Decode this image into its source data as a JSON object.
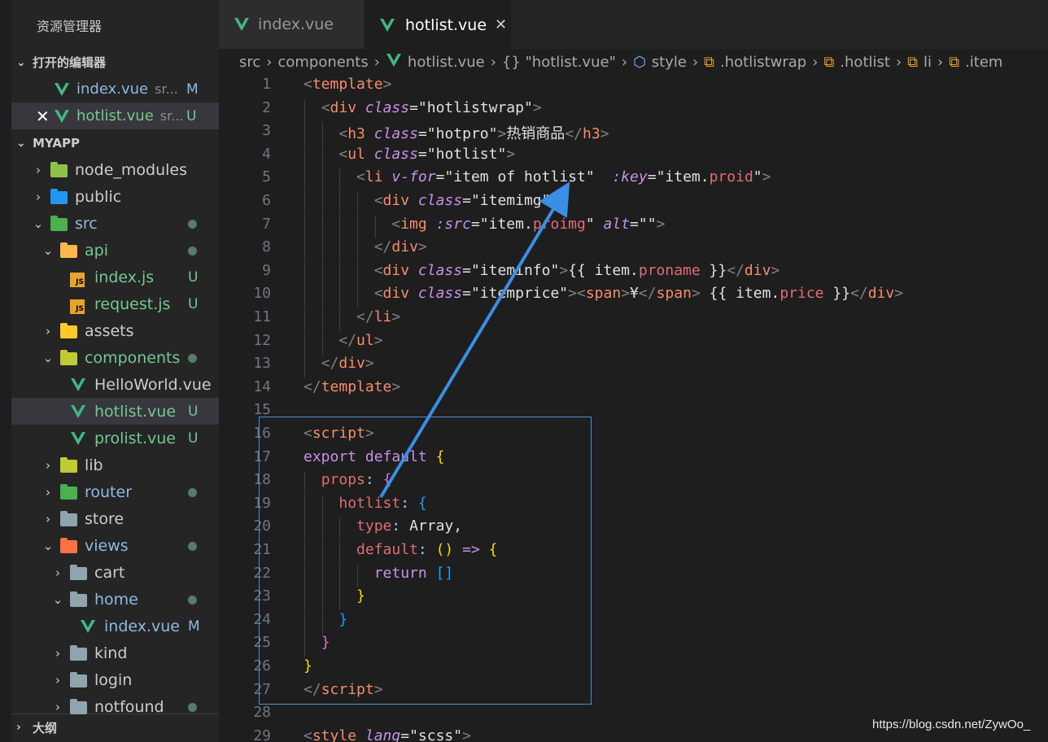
{
  "sidebar": {
    "title": "资源管理器",
    "open_editors": {
      "label": "打开的编辑器",
      "items": [
        {
          "name": "index.vue",
          "path": "sr...",
          "badge": "M",
          "active": false
        },
        {
          "name": "hotlist.vue",
          "path": "sr...",
          "badge": "U",
          "active": true
        }
      ]
    },
    "project": {
      "label": "MYAPP",
      "tree": [
        {
          "name": "node_modules",
          "indent": 0,
          "type": "folder",
          "icon_color": "#8bc34a",
          "chevron": "right"
        },
        {
          "name": "public",
          "indent": 0,
          "type": "folder",
          "icon_color": "#2196f3",
          "chevron": "right"
        },
        {
          "name": "src",
          "indent": 0,
          "type": "folder",
          "icon_color": "#4caf50",
          "chevron": "down",
          "dot": true,
          "color": "blue"
        },
        {
          "name": "api",
          "indent": 1,
          "type": "folder",
          "icon_color": "#ffb74d",
          "chevron": "down",
          "dot": true,
          "color": "mod"
        },
        {
          "name": "index.js",
          "indent": 2,
          "type": "js",
          "badge": "U",
          "color": "mod"
        },
        {
          "name": "request.js",
          "indent": 2,
          "type": "js",
          "badge": "U",
          "color": "mod"
        },
        {
          "name": "assets",
          "indent": 1,
          "type": "folder",
          "icon_color": "#ffca28",
          "chevron": "right"
        },
        {
          "name": "components",
          "indent": 1,
          "type": "folder",
          "icon_color": "#c0ca33",
          "chevron": "down",
          "dot": true,
          "color": "mod"
        },
        {
          "name": "HelloWorld.vue",
          "indent": 2,
          "type": "vue"
        },
        {
          "name": "hotlist.vue",
          "indent": 2,
          "type": "vue",
          "badge": "U",
          "color": "mod",
          "selected": true
        },
        {
          "name": "prolist.vue",
          "indent": 2,
          "type": "vue",
          "badge": "U",
          "color": "mod"
        },
        {
          "name": "lib",
          "indent": 1,
          "type": "folder",
          "icon_color": "#c0ca33",
          "chevron": "right"
        },
        {
          "name": "router",
          "indent": 1,
          "type": "folder",
          "icon_color": "#4caf50",
          "chevron": "right",
          "dot": true,
          "color": "blue"
        },
        {
          "name": "store",
          "indent": 1,
          "type": "folder",
          "icon_color": "#90a4ae",
          "chevron": "right"
        },
        {
          "name": "views",
          "indent": 1,
          "type": "folder",
          "icon_color": "#ff7043",
          "chevron": "down",
          "dot": true,
          "color": "blue"
        },
        {
          "name": "cart",
          "indent": 2,
          "type": "folder",
          "icon_color": "#90a4ae",
          "chevron": "right"
        },
        {
          "name": "home",
          "indent": 2,
          "type": "folder",
          "icon_color": "#90a4ae",
          "chevron": "down",
          "dot": true,
          "color": "blue"
        },
        {
          "name": "index.vue",
          "indent": 3,
          "type": "vue",
          "badge": "M",
          "color": "blue"
        },
        {
          "name": "kind",
          "indent": 2,
          "type": "folder",
          "icon_color": "#90a4ae",
          "chevron": "right"
        },
        {
          "name": "login",
          "indent": 2,
          "type": "folder",
          "icon_color": "#90a4ae",
          "chevron": "right"
        },
        {
          "name": "notfound",
          "indent": 2,
          "type": "folder",
          "icon_color": "#90a4ae",
          "chevron": "right",
          "dot": true
        }
      ]
    },
    "outline_label": "大纲"
  },
  "tabs": [
    {
      "name": "index.vue",
      "active": false
    },
    {
      "name": "hotlist.vue",
      "active": true,
      "close": "✕"
    }
  ],
  "breadcrumb": [
    "src",
    "components",
    "hotlist.vue",
    "{} \"hotlist.vue\"",
    "style",
    ".hotlistwrap",
    ".hotlist",
    "li",
    ".item"
  ],
  "code": {
    "line_numbers": [
      "1",
      "2",
      "3",
      "4",
      "5",
      "6",
      "7",
      "8",
      "9",
      "10",
      "11",
      "12",
      "13",
      "14",
      "15",
      "16",
      "17",
      "18",
      "19",
      "20",
      "21",
      "22",
      "23",
      "24",
      "25",
      "26",
      "27",
      "28",
      "29"
    ],
    "lines": [
      [
        {
          "t": "<",
          "c": "tagb"
        },
        {
          "t": "template",
          "c": "tag"
        },
        {
          "t": ">",
          "c": "tagb"
        }
      ],
      [
        {
          "t": "  "
        },
        {
          "t": "<",
          "c": "tagb"
        },
        {
          "t": "div",
          "c": "tag"
        },
        {
          "t": " "
        },
        {
          "t": "class",
          "c": "attr"
        },
        {
          "t": "=",
          "c": "plain"
        },
        {
          "t": "\"hotlistwrap\"",
          "c": "strw"
        },
        {
          "t": ">",
          "c": "tagb"
        }
      ],
      [
        {
          "t": "    "
        },
        {
          "t": "<",
          "c": "tagb"
        },
        {
          "t": "h3",
          "c": "tag"
        },
        {
          "t": " "
        },
        {
          "t": "class",
          "c": "attr"
        },
        {
          "t": "=",
          "c": "plain"
        },
        {
          "t": "\"hotpro\"",
          "c": "strw"
        },
        {
          "t": ">",
          "c": "tagb"
        },
        {
          "t": "热销商品",
          "c": "plain"
        },
        {
          "t": "</",
          "c": "tagb"
        },
        {
          "t": "h3",
          "c": "tag"
        },
        {
          "t": ">",
          "c": "tagb"
        }
      ],
      [
        {
          "t": "    "
        },
        {
          "t": "<",
          "c": "tagb"
        },
        {
          "t": "ul",
          "c": "tag"
        },
        {
          "t": " "
        },
        {
          "t": "class",
          "c": "attr"
        },
        {
          "t": "=",
          "c": "plain"
        },
        {
          "t": "\"hotlist\"",
          "c": "strw"
        },
        {
          "t": ">",
          "c": "tagb"
        }
      ],
      [
        {
          "t": "      "
        },
        {
          "t": "<",
          "c": "tagb"
        },
        {
          "t": "li",
          "c": "tag"
        },
        {
          "t": " "
        },
        {
          "t": "v-for",
          "c": "attr"
        },
        {
          "t": "=",
          "c": "plain"
        },
        {
          "t": "\"item of hotlist\"",
          "c": "strw"
        },
        {
          "t": "  "
        },
        {
          "t": ":key",
          "c": "attr"
        },
        {
          "t": "=",
          "c": "plain"
        },
        {
          "t": "\"item.",
          "c": "strw"
        },
        {
          "t": "proid",
          "c": "prop"
        },
        {
          "t": "\"",
          "c": "strw"
        },
        {
          "t": ">",
          "c": "tagb"
        }
      ],
      [
        {
          "t": "        "
        },
        {
          "t": "<",
          "c": "tagb"
        },
        {
          "t": "div",
          "c": "tag"
        },
        {
          "t": " "
        },
        {
          "t": "class",
          "c": "attr"
        },
        {
          "t": "=",
          "c": "plain"
        },
        {
          "t": "\"itemimg\"",
          "c": "strw"
        },
        {
          "t": ">",
          "c": "tagb"
        }
      ],
      [
        {
          "t": "          "
        },
        {
          "t": "<",
          "c": "tagb"
        },
        {
          "t": "img",
          "c": "tag"
        },
        {
          "t": " "
        },
        {
          "t": ":src",
          "c": "attr"
        },
        {
          "t": "=",
          "c": "plain"
        },
        {
          "t": "\"item.",
          "c": "strw"
        },
        {
          "t": "proimg",
          "c": "prop"
        },
        {
          "t": "\"",
          "c": "strw"
        },
        {
          "t": " "
        },
        {
          "t": "alt",
          "c": "attr"
        },
        {
          "t": "=",
          "c": "plain"
        },
        {
          "t": "\"\"",
          "c": "strw"
        },
        {
          "t": ">",
          "c": "tagb"
        }
      ],
      [
        {
          "t": "        "
        },
        {
          "t": "</",
          "c": "tagb"
        },
        {
          "t": "div",
          "c": "tag"
        },
        {
          "t": ">",
          "c": "tagb"
        }
      ],
      [
        {
          "t": "        "
        },
        {
          "t": "<",
          "c": "tagb"
        },
        {
          "t": "div",
          "c": "tag"
        },
        {
          "t": " "
        },
        {
          "t": "class",
          "c": "attr"
        },
        {
          "t": "=",
          "c": "plain"
        },
        {
          "t": "\"iteminfo\"",
          "c": "strw"
        },
        {
          "t": ">",
          "c": "tagb"
        },
        {
          "t": "{{ item.",
          "c": "plain"
        },
        {
          "t": "proname",
          "c": "prop"
        },
        {
          "t": " }}",
          "c": "plain"
        },
        {
          "t": "</",
          "c": "tagb"
        },
        {
          "t": "div",
          "c": "tag"
        },
        {
          "t": ">",
          "c": "tagb"
        }
      ],
      [
        {
          "t": "        "
        },
        {
          "t": "<",
          "c": "tagb"
        },
        {
          "t": "div",
          "c": "tag"
        },
        {
          "t": " "
        },
        {
          "t": "class",
          "c": "attr"
        },
        {
          "t": "=",
          "c": "plain"
        },
        {
          "t": "\"itemprice\"",
          "c": "strw"
        },
        {
          "t": ">",
          "c": "tagb"
        },
        {
          "t": "<",
          "c": "tagb"
        },
        {
          "t": "span",
          "c": "tag"
        },
        {
          "t": ">",
          "c": "tagb"
        },
        {
          "t": "¥",
          "c": "plain"
        },
        {
          "t": "</",
          "c": "tagb"
        },
        {
          "t": "span",
          "c": "tag"
        },
        {
          "t": ">",
          "c": "tagb"
        },
        {
          "t": " {{ item.",
          "c": "plain"
        },
        {
          "t": "price",
          "c": "prop"
        },
        {
          "t": " }}",
          "c": "plain"
        },
        {
          "t": "</",
          "c": "tagb"
        },
        {
          "t": "div",
          "c": "tag"
        },
        {
          "t": ">",
          "c": "tagb"
        }
      ],
      [
        {
          "t": "      "
        },
        {
          "t": "</",
          "c": "tagb"
        },
        {
          "t": "li",
          "c": "tag"
        },
        {
          "t": ">",
          "c": "tagb"
        }
      ],
      [
        {
          "t": "    "
        },
        {
          "t": "</",
          "c": "tagb"
        },
        {
          "t": "ul",
          "c": "tag"
        },
        {
          "t": ">",
          "c": "tagb"
        }
      ],
      [
        {
          "t": "  "
        },
        {
          "t": "</",
          "c": "tagb"
        },
        {
          "t": "div",
          "c": "tag"
        },
        {
          "t": ">",
          "c": "tagb"
        }
      ],
      [
        {
          "t": "</",
          "c": "tagb"
        },
        {
          "t": "template",
          "c": "tag"
        },
        {
          "t": ">",
          "c": "tagb"
        }
      ],
      [],
      [
        {
          "t": "<",
          "c": "tagb"
        },
        {
          "t": "script",
          "c": "tag"
        },
        {
          "t": ">",
          "c": "tagb"
        }
      ],
      [
        {
          "t": "export default ",
          "c": "kw"
        },
        {
          "t": "{",
          "c": "br1"
        }
      ],
      [
        {
          "t": "  "
        },
        {
          "t": "props",
          "c": "prop"
        },
        {
          "t": ": ",
          "c": "punc"
        },
        {
          "t": "{",
          "c": "br2"
        }
      ],
      [
        {
          "t": "    "
        },
        {
          "t": "hotlist",
          "c": "prop"
        },
        {
          "t": ": ",
          "c": "punc"
        },
        {
          "t": "{",
          "c": "br3"
        }
      ],
      [
        {
          "t": "      "
        },
        {
          "t": "type",
          "c": "prop"
        },
        {
          "t": ": ",
          "c": "punc"
        },
        {
          "t": "Array,",
          "c": "plain"
        }
      ],
      [
        {
          "t": "      "
        },
        {
          "t": "default",
          "c": "prop"
        },
        {
          "t": ": ",
          "c": "punc"
        },
        {
          "t": "()",
          "c": "br1"
        },
        {
          "t": " => ",
          "c": "kw"
        },
        {
          "t": "{",
          "c": "br1"
        }
      ],
      [
        {
          "t": "        "
        },
        {
          "t": "return ",
          "c": "kw"
        },
        {
          "t": "[]",
          "c": "br3"
        }
      ],
      [
        {
          "t": "      "
        },
        {
          "t": "}",
          "c": "br1"
        }
      ],
      [
        {
          "t": "    "
        },
        {
          "t": "}",
          "c": "br3"
        }
      ],
      [
        {
          "t": "  "
        },
        {
          "t": "}",
          "c": "br2"
        }
      ],
      [
        {
          "t": "}",
          "c": "br1"
        }
      ],
      [
        {
          "t": "</",
          "c": "tagb"
        },
        {
          "t": "script",
          "c": "tag"
        },
        {
          "t": ">",
          "c": "tagb"
        }
      ],
      [],
      [
        {
          "t": "<",
          "c": "tagb"
        },
        {
          "t": "style",
          "c": "tag"
        },
        {
          "t": " "
        },
        {
          "t": "lang",
          "c": "attr"
        },
        {
          "t": "=",
          "c": "plain"
        },
        {
          "t": "\"scss\"",
          "c": "strw"
        },
        {
          "t": ">",
          "c": "tagb"
        }
      ]
    ]
  },
  "watermark": "https://blog.csdn.net/ZywOo_",
  "colors": {
    "modified": "#73c991",
    "untracked_badge": "#73c991",
    "m_badge": "#e2c08d",
    "annotation": "#4d8fd6",
    "vue_icon": "#41b883"
  }
}
